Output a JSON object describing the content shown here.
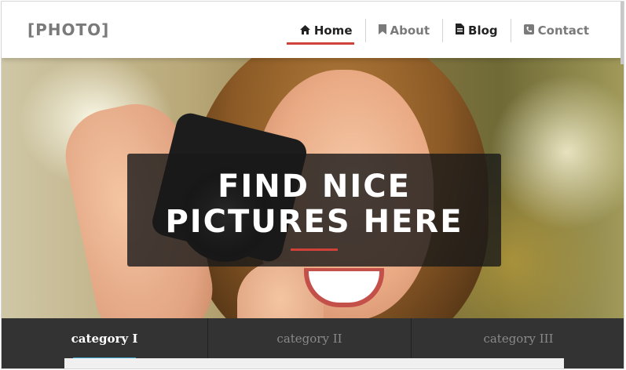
{
  "header": {
    "logo": "[PHOTO]",
    "nav": [
      {
        "label": "Home",
        "icon": "home-icon",
        "active": true
      },
      {
        "label": "About",
        "icon": "bookmark-icon",
        "active": false
      },
      {
        "label": "Blog",
        "icon": "document-icon",
        "active": false
      },
      {
        "label": "Contact",
        "icon": "phone-icon",
        "active": false
      }
    ]
  },
  "hero": {
    "title": "FIND NICE PICTURES HERE"
  },
  "categories": [
    {
      "label": "category I",
      "active": true
    },
    {
      "label": "category II",
      "active": false
    },
    {
      "label": "category III",
      "active": false
    }
  ],
  "colors": {
    "accent_red": "#d0413a",
    "accent_blue": "#3fa8d3",
    "bar_bg": "#333333"
  }
}
